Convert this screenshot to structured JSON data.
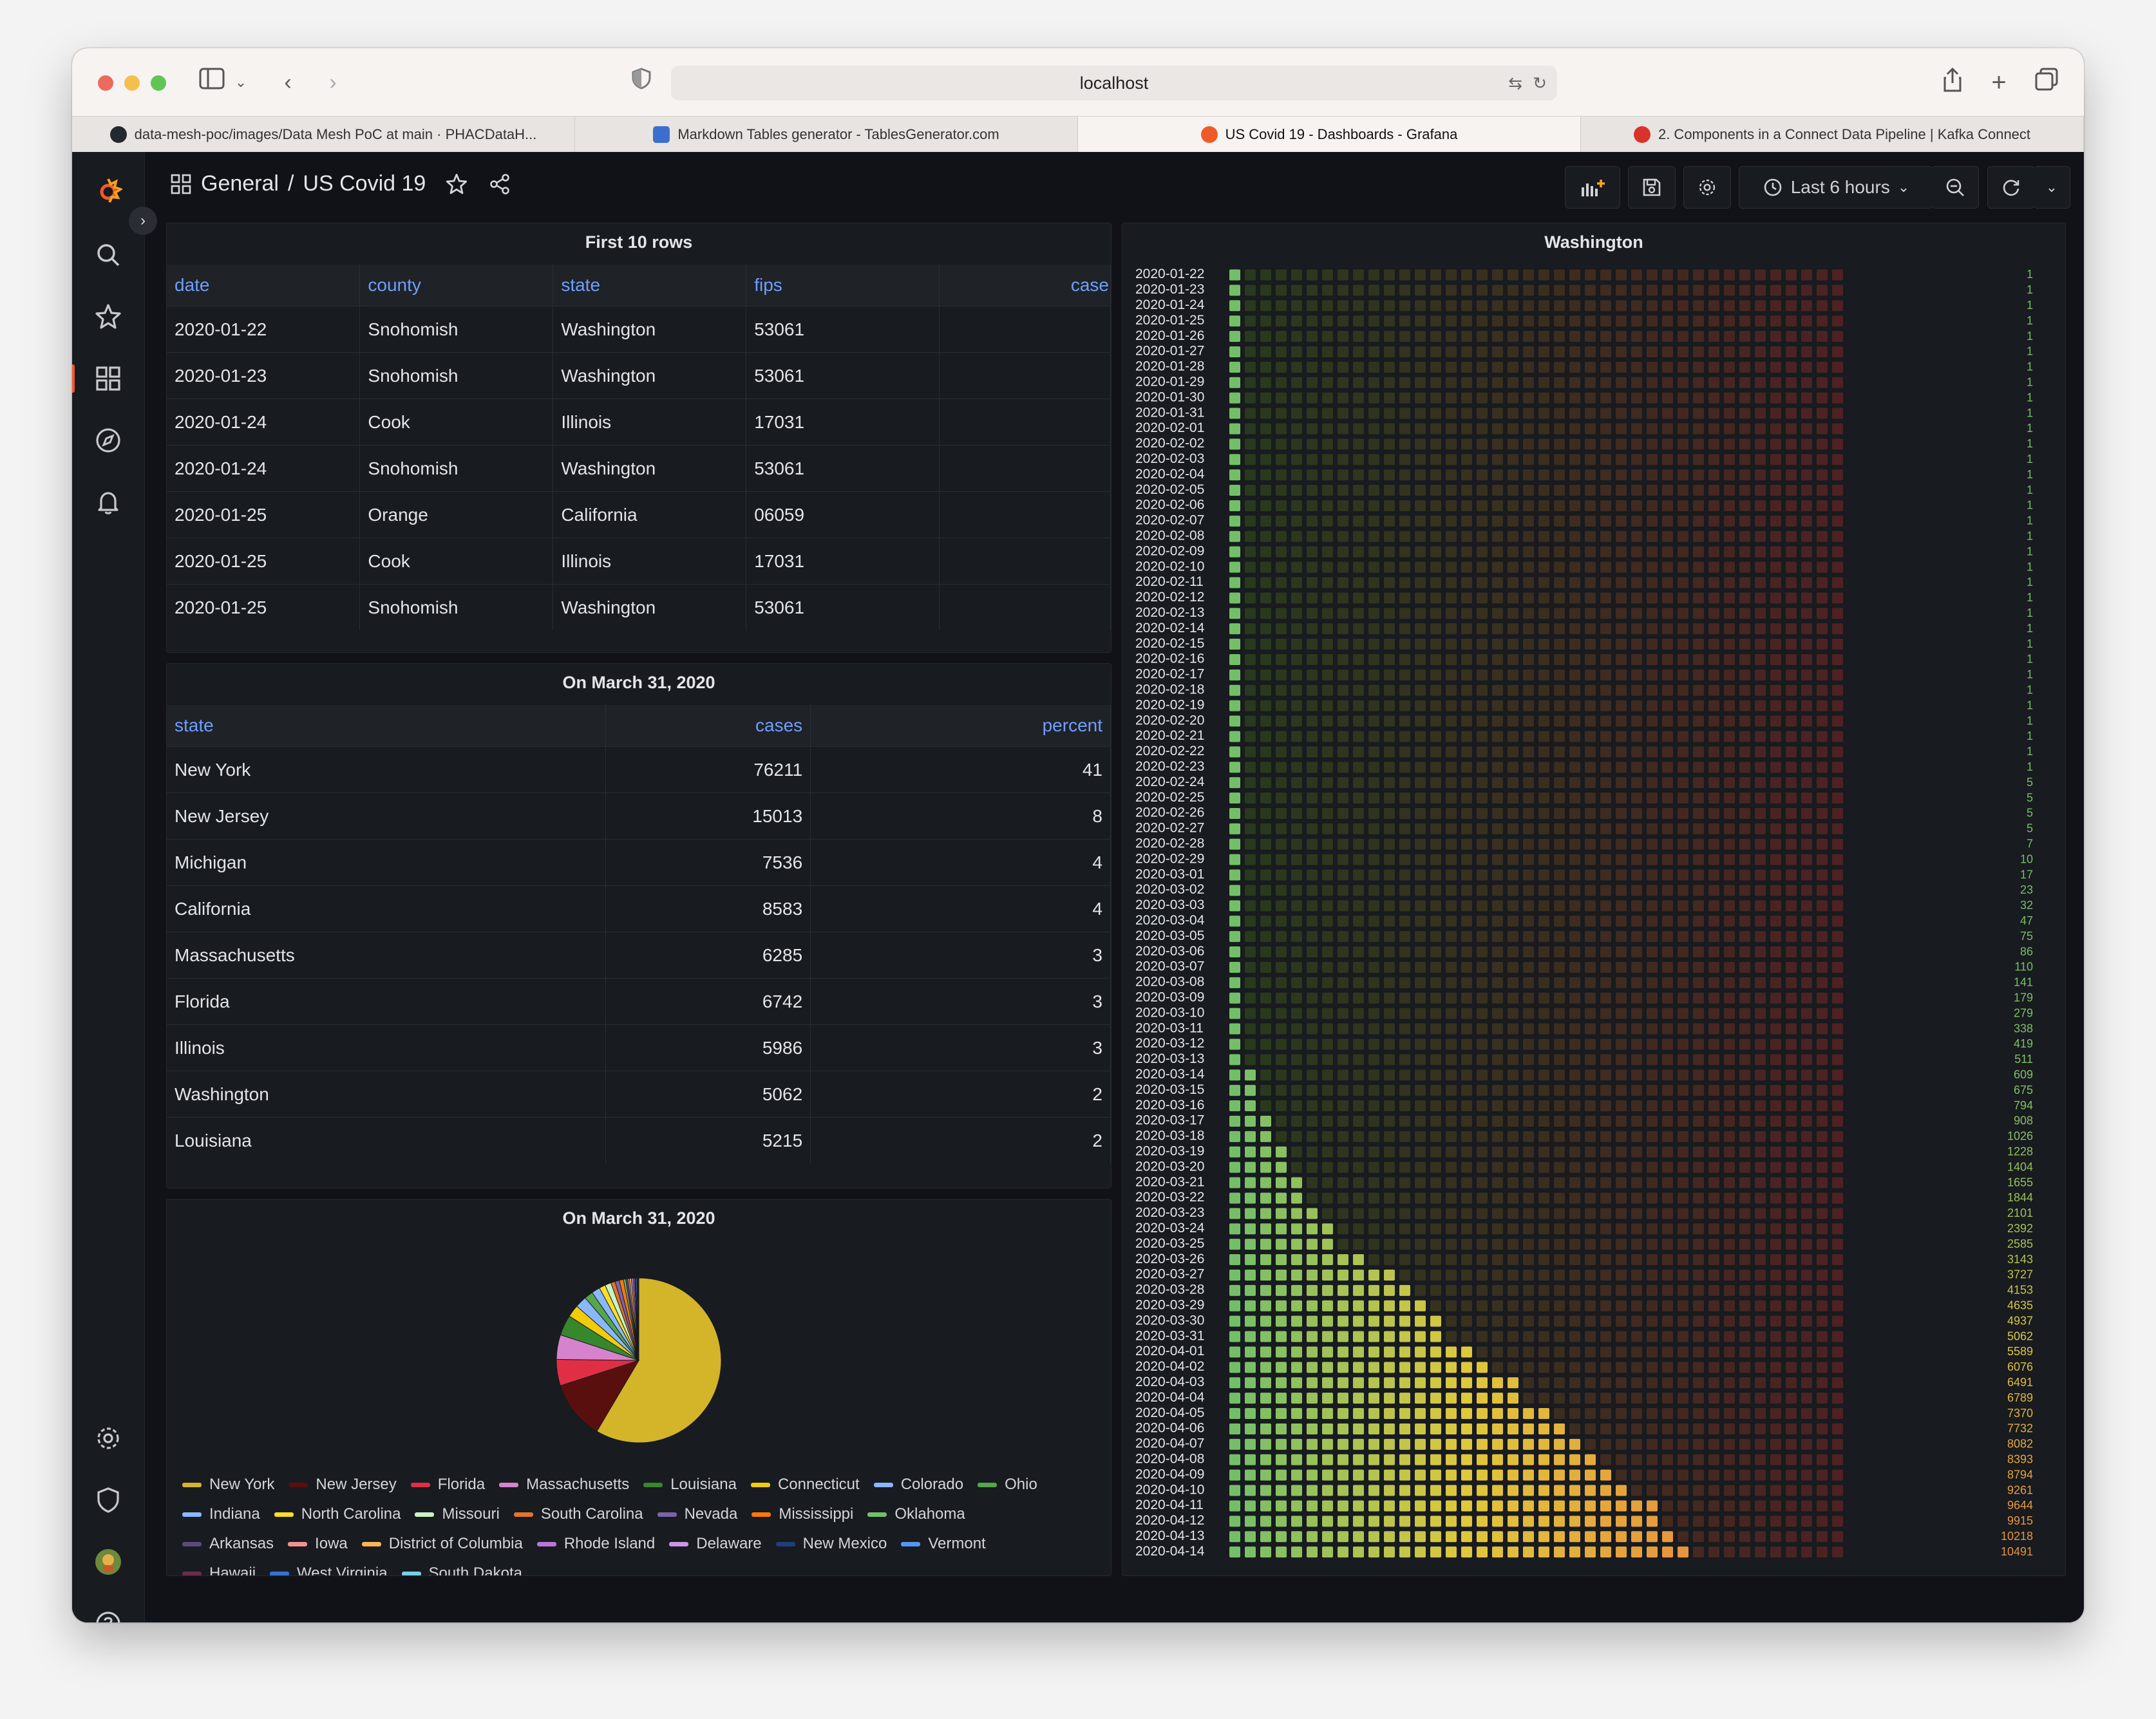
{
  "browser": {
    "address": "localhost",
    "tabs": [
      {
        "label": "data-mesh-poc/images/Data Mesh PoC at main · PHACDataH...",
        "favicon_color": "#24292f",
        "active": false
      },
      {
        "label": "Markdown Tables generator - TablesGenerator.com",
        "favicon_color": "#3b6fcf",
        "active": false
      },
      {
        "label": "US Covid 19 - Dashboards - Grafana",
        "favicon_color": "#f05a28",
        "active": true
      },
      {
        "label": "2. Components in a Connect Data Pipeline | Kafka Connect",
        "favicon_color": "#d9342b",
        "active": false
      }
    ]
  },
  "dashboard": {
    "folder": "General",
    "separator": "/",
    "title": "US Covid 19",
    "time_range": "Last 6 hours"
  },
  "first_rows": {
    "title": "First 10 rows",
    "columns": [
      "date",
      "county",
      "state",
      "fips",
      "case"
    ],
    "rows": [
      [
        "2020-01-22",
        "Snohomish",
        "Washington",
        "53061",
        ""
      ],
      [
        "2020-01-23",
        "Snohomish",
        "Washington",
        "53061",
        ""
      ],
      [
        "2020-01-24",
        "Cook",
        "Illinois",
        "17031",
        ""
      ],
      [
        "2020-01-24",
        "Snohomish",
        "Washington",
        "53061",
        ""
      ],
      [
        "2020-01-25",
        "Orange",
        "California",
        "06059",
        ""
      ],
      [
        "2020-01-25",
        "Cook",
        "Illinois",
        "17031",
        ""
      ],
      [
        "2020-01-25",
        "Snohomish",
        "Washington",
        "53061",
        ""
      ]
    ]
  },
  "state_table": {
    "title": "On March 31, 2020",
    "columns": [
      "state",
      "cases",
      "percent"
    ],
    "rows": [
      [
        "New York",
        "76211",
        "41"
      ],
      [
        "New Jersey",
        "15013",
        "8"
      ],
      [
        "Michigan",
        "7536",
        "4"
      ],
      [
        "California",
        "8583",
        "4"
      ],
      [
        "Massachusetts",
        "6285",
        "3"
      ],
      [
        "Florida",
        "6742",
        "3"
      ],
      [
        "Illinois",
        "5986",
        "3"
      ],
      [
        "Washington",
        "5062",
        "2"
      ],
      [
        "Louisiana",
        "5215",
        "2"
      ]
    ]
  },
  "colors": {
    "grafana_bg": "#111217",
    "panel_bg": "#181b1f",
    "link_blue": "#6e9fff",
    "grafana_orange": "#f05a28"
  },
  "chart_data": [
    {
      "type": "pie",
      "title": "On March 31, 2020",
      "labels": [
        "New York",
        "New Jersey",
        "Florida",
        "Massachusetts",
        "Louisiana",
        "Connecticut",
        "Colorado",
        "Ohio",
        "Indiana",
        "North Carolina",
        "Missouri",
        "South Carolina",
        "Nevada",
        "Mississippi",
        "Oklahoma",
        "Arkansas",
        "Iowa",
        "District of Columbia",
        "Rhode Island",
        "Delaware",
        "New Mexico",
        "Vermont",
        "Hawaii",
        "West Virginia",
        "South Dakota"
      ],
      "values": [
        76211,
        15013,
        6742,
        6285,
        5215,
        3128,
        2990,
        2199,
        2159,
        1584,
        1581,
        1083,
        1113,
        1073,
        565,
        523,
        424,
        495,
        488,
        319,
        315,
        293,
        204,
        162,
        108
      ],
      "colors": [
        "#d4b429",
        "#5a0f0f",
        "#e02f44",
        "#d683ce",
        "#37872d",
        "#f2cc0c",
        "#8ab8ff",
        "#56a64b",
        "#8ab8ff",
        "#fade2a",
        "#c8f2c2",
        "#e0752d",
        "#7a64a8",
        "#ff780a",
        "#73bf69",
        "#5d4a7d",
        "#f29191",
        "#ffb357",
        "#b877d9",
        "#ca95e5",
        "#1f3f7a",
        "#5794f2",
        "#6e2b4d",
        "#3274d9",
        "#73d1e8"
      ]
    },
    {
      "type": "heatmap",
      "title": "Washington",
      "dates": [
        "2020-01-22",
        "2020-01-23",
        "2020-01-24",
        "2020-01-25",
        "2020-01-26",
        "2020-01-27",
        "2020-01-28",
        "2020-01-29",
        "2020-01-30",
        "2020-01-31",
        "2020-02-01",
        "2020-02-02",
        "2020-02-03",
        "2020-02-04",
        "2020-02-05",
        "2020-02-06",
        "2020-02-07",
        "2020-02-08",
        "2020-02-09",
        "2020-02-10",
        "2020-02-11",
        "2020-02-12",
        "2020-02-13",
        "2020-02-14",
        "2020-02-15",
        "2020-02-16",
        "2020-02-17",
        "2020-02-18",
        "2020-02-19",
        "2020-02-20",
        "2020-02-21",
        "2020-02-22",
        "2020-02-23",
        "2020-02-24",
        "2020-02-25",
        "2020-02-26",
        "2020-02-27",
        "2020-02-28",
        "2020-02-29",
        "2020-03-01",
        "2020-03-02",
        "2020-03-03",
        "2020-03-04",
        "2020-03-05",
        "2020-03-06",
        "2020-03-07",
        "2020-03-08",
        "2020-03-09",
        "2020-03-10",
        "2020-03-11",
        "2020-03-12",
        "2020-03-13",
        "2020-03-14",
        "2020-03-15",
        "2020-03-16",
        "2020-03-17",
        "2020-03-18",
        "2020-03-19",
        "2020-03-20",
        "2020-03-21",
        "2020-03-22",
        "2020-03-23",
        "2020-03-24",
        "2020-03-25",
        "2020-03-26",
        "2020-03-27",
        "2020-03-28",
        "2020-03-29",
        "2020-03-30",
        "2020-03-31",
        "2020-04-01",
        "2020-04-02",
        "2020-04-03",
        "2020-04-04",
        "2020-04-05",
        "2020-04-06",
        "2020-04-07",
        "2020-04-08",
        "2020-04-09",
        "2020-04-10",
        "2020-04-11",
        "2020-04-12",
        "2020-04-13",
        "2020-04-14"
      ],
      "values": [
        1,
        1,
        1,
        1,
        1,
        1,
        1,
        1,
        1,
        1,
        1,
        1,
        1,
        1,
        1,
        1,
        1,
        1,
        1,
        1,
        1,
        1,
        1,
        1,
        1,
        1,
        1,
        1,
        1,
        1,
        1,
        1,
        1,
        5,
        5,
        5,
        5,
        7,
        10,
        17,
        23,
        32,
        47,
        75,
        86,
        110,
        141,
        179,
        279,
        338,
        419,
        511,
        609,
        675,
        794,
        908,
        1026,
        1228,
        1404,
        1655,
        1844,
        2101,
        2392,
        2585,
        3143,
        3727,
        4153,
        4635,
        4937,
        5062,
        5589,
        6076,
        6491,
        6789,
        7370,
        7732,
        8082,
        8393,
        8794,
        9261,
        9644,
        9915,
        10218,
        10491
      ],
      "max": 10491
    }
  ]
}
